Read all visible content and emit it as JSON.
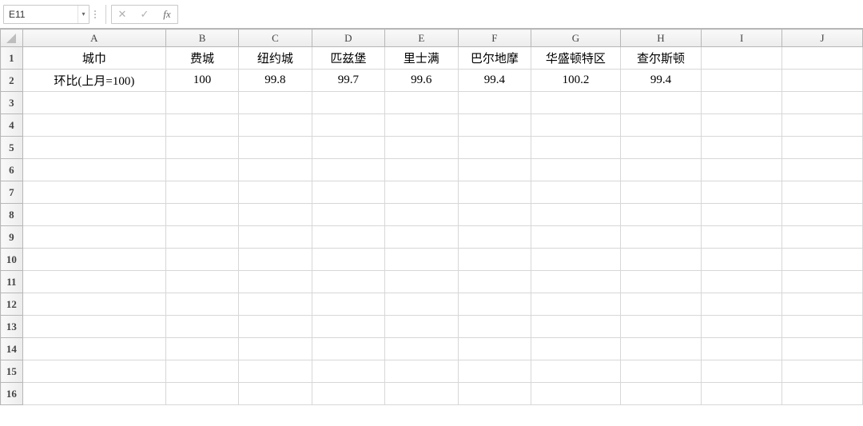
{
  "formula_bar": {
    "cell_ref": "E11",
    "dropdown_glyph": "▾",
    "cancel_glyph": "✕",
    "confirm_glyph": "✓",
    "fx_label": "fx",
    "formula_value": ""
  },
  "columns": [
    "A",
    "B",
    "C",
    "D",
    "E",
    "F",
    "G",
    "H",
    "I",
    "J"
  ],
  "visible_rows": 16,
  "sheet": {
    "row1": {
      "A": "城巾",
      "B": "费城",
      "C": "纽约城",
      "D": "匹兹堡",
      "E": "里士满",
      "F": "巴尔地摩",
      "G": "华盛顿特区",
      "H": "查尔斯顿"
    },
    "row2": {
      "A": "环比(上月=100)",
      "B": "100",
      "C": "99.8",
      "D": "99.7",
      "E": "99.6",
      "F": "99.4",
      "G": "100.2",
      "H": "99.4"
    }
  },
  "chart_data": {
    "type": "table",
    "title": "",
    "columns": [
      "城巾",
      "费城",
      "纽约城",
      "匹兹堡",
      "里士满",
      "巴尔地摩",
      "华盛顿特区",
      "查尔斯顿"
    ],
    "rows": [
      [
        "环比(上月=100)",
        100,
        99.8,
        99.7,
        99.6,
        99.4,
        100.2,
        99.4
      ]
    ]
  }
}
